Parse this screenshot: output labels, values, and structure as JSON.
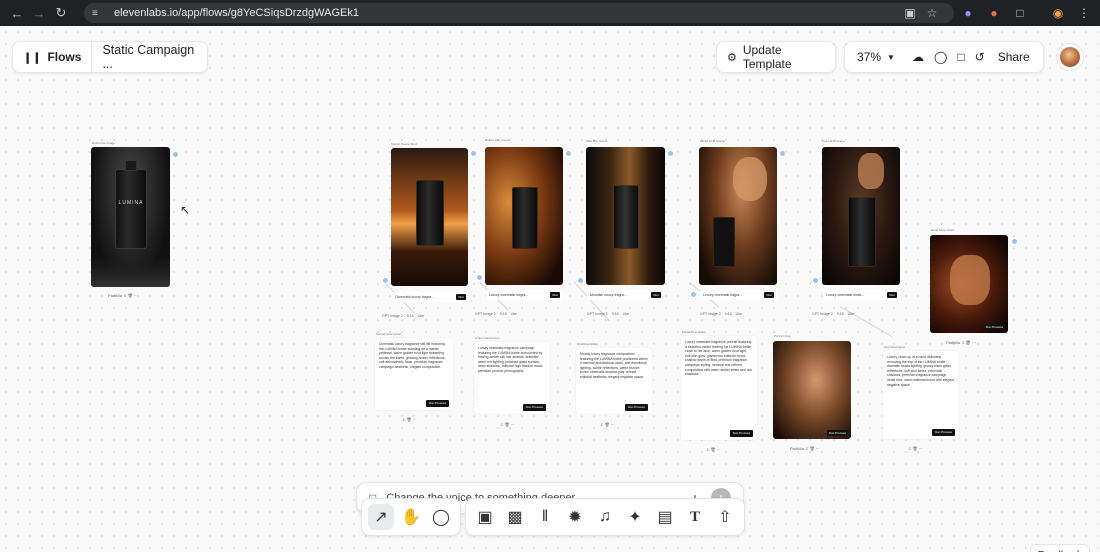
{
  "browser": {
    "url": "elevenlabs.io/app/flows/g8YeCSiqsDrzdgWAGEk1"
  },
  "header": {
    "flows_label": "Flows",
    "project_title": "Static Campaign ...",
    "update_template_label": "Update Template",
    "zoom": "37%",
    "share_label": "Share"
  },
  "nodes": {
    "reference": {
      "title": "Reference Image",
      "product_text": "LUMINA",
      "footer": "Padiklia"
    },
    "images": [
      {
        "title": "Sunset Scene Shot",
        "model": "GPT Image 1",
        "prompt": "Cinematic luxury fragra...",
        "tag": "Run"
      },
      {
        "title": "Amber Hair Scene",
        "model": "GPT Image 1",
        "prompt": "Luxury cinematic fragra...",
        "tag": "Run"
      },
      {
        "title": "Side Rim Scene",
        "model": "GPT Image 1",
        "prompt": "Moodish luxury fragra...",
        "tag": "Run"
      },
      {
        "title": "Model Hold Scene",
        "model": "GPT Image 1",
        "prompt": "Luxury cinematic fragra...",
        "tag": "Run"
      },
      {
        "title": "Cap Hand Scene",
        "model": "GPT Image 1",
        "prompt": "Luxury cinematic close...",
        "tag": "Run"
      }
    ],
    "extra_image": {
      "title": "Hand Glow Video",
      "footer": "Padiklia",
      "run": "Run Process"
    },
    "portrait": {
      "title": "Portrait Crop",
      "footer": "Padiklia",
      "run": "Run Process"
    },
    "meta": {
      "model": "GPT Image 2",
      "ratio": "9:16",
      "likes": "Like"
    },
    "text_cards": [
      {
        "title": "Sunset Description",
        "text": "Cinematic luxury fragrance still life featuring the LUMINA bottle standing on a marble pedestal, warm golden hour light streaming across the frame, glowing amber reflections, soft atmospheric haze, premium fragrance campaign aesthetic, elegant composition.",
        "run": "Run Process"
      },
      {
        "title": "Amber Description",
        "text": "Luxury cinematic fragrance campaign featuring the LUMINA bottle surrounded by flowing amber silk hair strands, dramatic warm rim lighting, polished glass surface, deep shadows, editorial high fashion mood, premium product photography.",
        "run": "Run Process"
      },
      {
        "title": "Rim Description",
        "text": "Moody luxury fragrance composition featuring the LUMINA bottle positioned within a minimal architectural niche, soft directional lighting, subtle reflections, warm bronze tones, cinematic shadow play, refined editorial aesthetic, elegant negative space.",
        "run": "Run Process"
      },
      {
        "title": "Model Description",
        "text": "Luxury cinematic fragrance portrait featuring a beautiful model holding the LUMINA bottle close to her face, warm golden hour light, soft skin glow, glamorous editorial mood, shallow depth of field, premium fragrance campaign styling, sensual and refined composition with warm amber tones and rich shadows.",
        "run": "Run Process"
      },
      {
        "title": "Cap Description",
        "text": "Luxury close-up of a hand delicately removing the cap of the LUMINA bottle, dramatic studio lighting, glossy black glass reflections, soft skin tones, cinematic shadows, premium fragrance campaign detail shot, warm editorial mood with elegant negative space.",
        "run": "Run Process"
      }
    ]
  },
  "composer": {
    "placeholder": "Change the voice to something deeper..."
  },
  "tools": [
    "select",
    "hand",
    "comment",
    "image",
    "video",
    "audio",
    "enhance",
    "music",
    "magic",
    "upscale",
    "text",
    "upload"
  ],
  "feedback_label": "Feedback",
  "colors": {
    "accent": "#9ec1f2",
    "dark": "#111111",
    "chrome": "#202124"
  }
}
